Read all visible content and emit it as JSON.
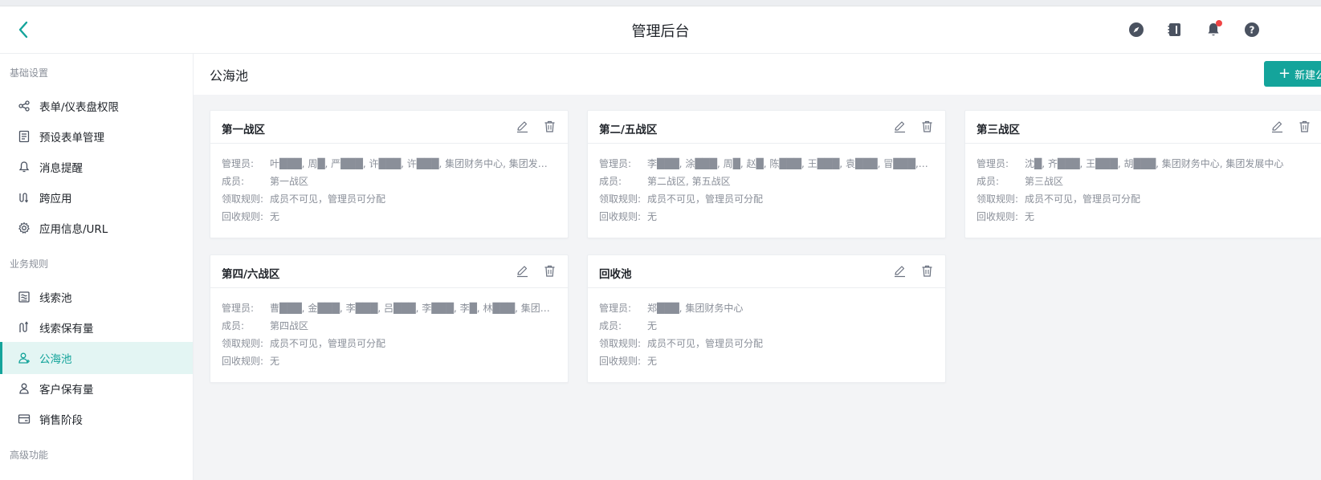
{
  "header": {
    "title": "管理后台"
  },
  "sidebar": {
    "groups": [
      {
        "title": "基础设置"
      },
      {
        "title": "业务规则"
      },
      {
        "title": "高级功能"
      }
    ],
    "items": [
      {
        "label": "表单/仪表盘权限",
        "icon": "share-icon"
      },
      {
        "label": "预设表单管理",
        "icon": "form-doc-icon"
      },
      {
        "label": "消息提醒",
        "icon": "bell-icon"
      },
      {
        "label": "跨应用",
        "icon": "cross-app-icon"
      },
      {
        "label": "应用信息/URL",
        "icon": "gear-icon"
      },
      {
        "label": "线索池",
        "icon": "lead-pool-icon"
      },
      {
        "label": "线索保有量",
        "icon": "lead-retention-icon"
      },
      {
        "label": "公海池",
        "icon": "user-pool-icon",
        "active": true
      },
      {
        "label": "客户保有量",
        "icon": "user-icon"
      },
      {
        "label": "销售阶段",
        "icon": "card-icon"
      }
    ]
  },
  "main": {
    "title": "公海池",
    "new_button": "新建公海池",
    "labels": {
      "admins": "管理员:",
      "members": "成员:",
      "claim_rule": "领取规则:",
      "recycle_rule": "回收规则:"
    },
    "cards": [
      {
        "title": "第一战区",
        "admins": "叶███, 周█, 严███, 许███, 许███, 集团财务中心, 集团发展中心",
        "members": "第一战区",
        "claim_rule": "成员不可见，管理员可分配",
        "recycle_rule": "无"
      },
      {
        "title": "第二/五战区",
        "admins": "李███, 涂███, 周█, 赵█, 陈███, 王███, 袁███, 冒███, 侯███...",
        "members": "第二战区, 第五战区",
        "claim_rule": "成员不可见，管理员可分配",
        "recycle_rule": "无"
      },
      {
        "title": "第三战区",
        "admins": "沈█, 齐███, 王███, 胡███, 集团财务中心, 集团发展中心",
        "members": "第三战区",
        "claim_rule": "成员不可见，管理员可分配",
        "recycle_rule": "无"
      },
      {
        "title": "第四/六战区",
        "admins": "曹███, 金███, 李███, 吕███, 李███, 李█, 林███, 集团财务中...",
        "members": "第四战区",
        "claim_rule": "成员不可见，管理员可分配",
        "recycle_rule": "无"
      },
      {
        "title": "回收池",
        "admins": "郑███, 集团财务中心",
        "members": "无",
        "claim_rule": "成员不可见，管理员可分配",
        "recycle_rule": "无"
      }
    ]
  },
  "colors": {
    "accent": "#14a49b",
    "active_bg": "#e3f5f3",
    "notification": "#f04444",
    "muted_text": "#8a8f99"
  }
}
